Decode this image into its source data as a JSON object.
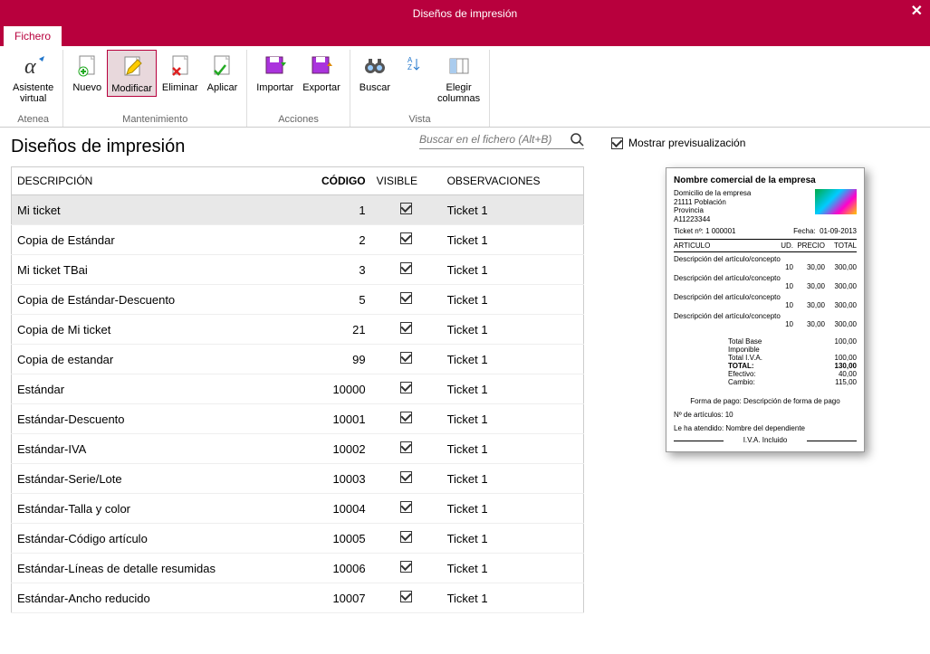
{
  "titlebar": {
    "title": "Diseños de impresión"
  },
  "tab": {
    "label": "Fichero"
  },
  "ribbon": {
    "groups": [
      {
        "label": "Atenea",
        "buttons": [
          {
            "label": "Asistente\nvirtual",
            "icon": "alpha"
          }
        ]
      },
      {
        "label": "Mantenimiento",
        "buttons": [
          {
            "label": "Nuevo",
            "icon": "doc-plus"
          },
          {
            "label": "Modificar",
            "icon": "doc-pencil",
            "active": true
          },
          {
            "label": "Eliminar",
            "icon": "doc-x"
          },
          {
            "label": "Aplicar",
            "icon": "doc-check"
          }
        ]
      },
      {
        "label": "Acciones",
        "buttons": [
          {
            "label": "Importar",
            "icon": "disk-in"
          },
          {
            "label": "Exportar",
            "icon": "disk-out"
          }
        ]
      },
      {
        "label": "Vista",
        "buttons": [
          {
            "label": "Buscar",
            "icon": "binoc"
          },
          {
            "label": "",
            "icon": "sort",
            "small": true
          },
          {
            "label": "Elegir\ncolumnas",
            "icon": "columns"
          }
        ]
      }
    ]
  },
  "page": {
    "title": "Diseños de impresión"
  },
  "search": {
    "placeholder": "Buscar en el fichero (Alt+B)"
  },
  "table": {
    "headers": {
      "desc": "DESCRIPCIÓN",
      "code": "CÓDIGO",
      "visible": "VISIBLE",
      "obs": "OBSERVACIONES"
    },
    "rows": [
      {
        "desc": "Mi ticket",
        "code": "1",
        "visible": true,
        "obs": "Ticket 1",
        "selected": true
      },
      {
        "desc": "Copia de Estándar",
        "code": "2",
        "visible": true,
        "obs": "Ticket 1"
      },
      {
        "desc": "Mi ticket TBai",
        "code": "3",
        "visible": true,
        "obs": "Ticket 1"
      },
      {
        "desc": "Copia de Estándar-Descuento",
        "code": "5",
        "visible": true,
        "obs": "Ticket 1"
      },
      {
        "desc": "Copia de Mi ticket",
        "code": "21",
        "visible": true,
        "obs": "Ticket 1"
      },
      {
        "desc": "Copia de estandar",
        "code": "99",
        "visible": true,
        "obs": "Ticket 1"
      },
      {
        "desc": "Estándar",
        "code": "10000",
        "visible": true,
        "obs": "Ticket 1"
      },
      {
        "desc": "Estándar-Descuento",
        "code": "10001",
        "visible": true,
        "obs": "Ticket 1"
      },
      {
        "desc": "Estándar-IVA",
        "code": "10002",
        "visible": true,
        "obs": "Ticket 1"
      },
      {
        "desc": "Estándar-Serie/Lote",
        "code": "10003",
        "visible": true,
        "obs": "Ticket 1"
      },
      {
        "desc": "Estándar-Talla y color",
        "code": "10004",
        "visible": true,
        "obs": "Ticket 1"
      },
      {
        "desc": "Estándar-Código artículo",
        "code": "10005",
        "visible": true,
        "obs": "Ticket 1"
      },
      {
        "desc": "Estándar-Líneas de detalle resumidas",
        "code": "10006",
        "visible": true,
        "obs": "Ticket 1"
      },
      {
        "desc": "Estándar-Ancho reducido",
        "code": "10007",
        "visible": true,
        "obs": "Ticket 1"
      }
    ]
  },
  "preview": {
    "show_label": "Mostrar previsualización",
    "company": "Nombre comercial de la empresa",
    "addr1": "Domicilio de la empresa",
    "addr2": "21111    Población",
    "addr3": "Provincia",
    "addr4": "A11223344",
    "ticket_lbl": "Ticket nº:",
    "ticket_no": "1   000001",
    "fecha_lbl": "Fecha:",
    "fecha": "01-09-2013",
    "th_art": "ARTICULO",
    "th_ud": "UD.",
    "th_precio": "PRECIO",
    "th_total": "TOTAL",
    "line_desc": "Descripción del artículo/concepto",
    "line_ud": "10",
    "line_pr": "30,00",
    "line_tot": "300,00",
    "tot_base_lbl": "Total Base Imponible",
    "tot_base": "100,00",
    "tot_iva_lbl": "Total I.V.A.",
    "tot_iva": "100,00",
    "tot_lbl": "TOTAL:",
    "tot": "130,00",
    "efectivo_lbl": "Efectivo:",
    "efectivo": "40,00",
    "cambio_lbl": "Cambio:",
    "cambio": "115,00",
    "forma_pago": "Forma de pago: Descripción de forma de pago",
    "n_art": "Nº de artículos:  10",
    "atendido": "Le ha atendido:  Nombre del dependiente",
    "iva_inc": "I.V.A. Incluido"
  }
}
